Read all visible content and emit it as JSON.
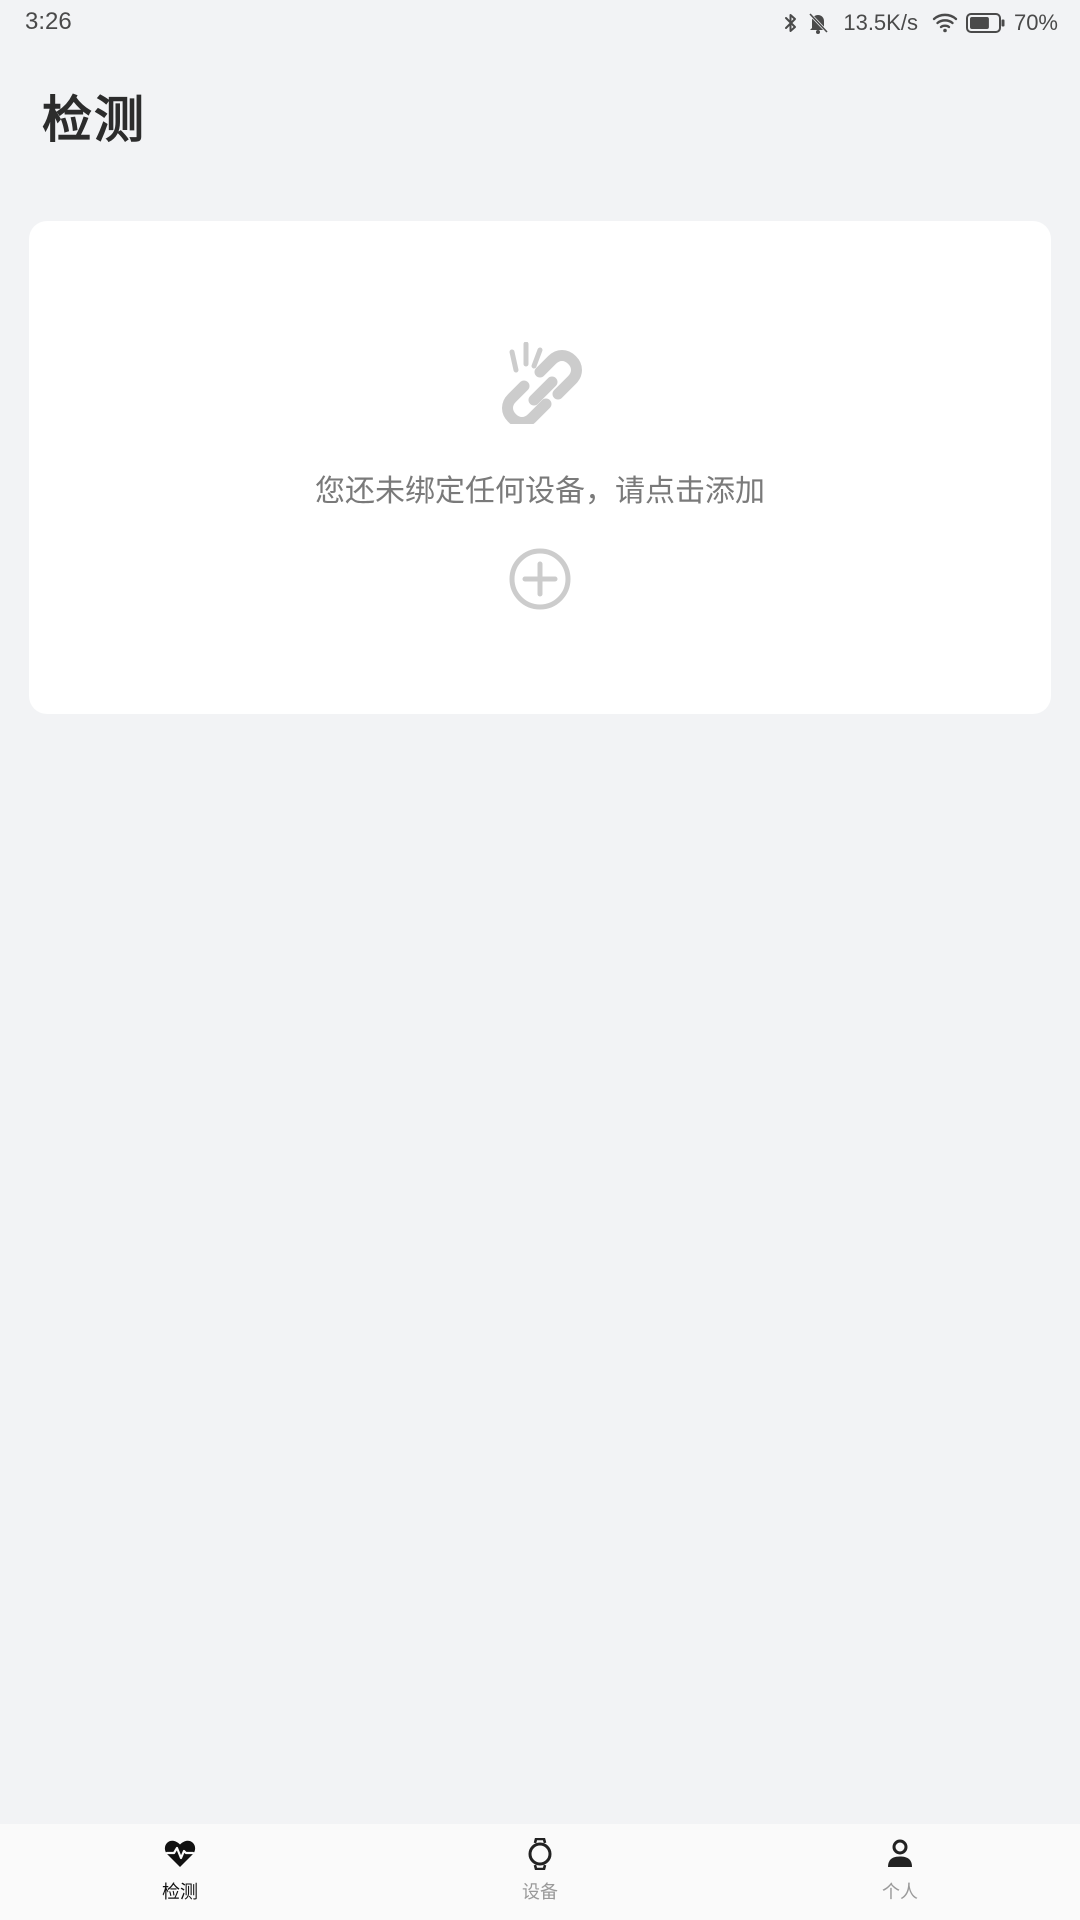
{
  "status_bar": {
    "time": "3:26",
    "network_speed": "13.5K/s",
    "battery": "70%",
    "battery_level": 0.7,
    "icons": [
      "bluetooth-icon",
      "bell-off-icon",
      "wifi-icon",
      "battery-icon"
    ]
  },
  "header": {
    "title": "检测"
  },
  "empty_card": {
    "icon": "broken-link-icon",
    "message": "您还未绑定任何设备，请点击添加",
    "add_icon": "plus-circle-icon"
  },
  "tab_bar": {
    "tabs": [
      {
        "label": "检测",
        "icon": "heart-pulse-icon",
        "active": true
      },
      {
        "label": "设备",
        "icon": "watch-icon",
        "active": false
      },
      {
        "label": "个人",
        "icon": "person-icon",
        "active": false
      }
    ]
  },
  "colors": {
    "background": "#f2f3f5",
    "card": "#ffffff",
    "icon_gray": "#cccccc",
    "active_tab": "#111111",
    "inactive_tab": "#9a9a9a"
  }
}
